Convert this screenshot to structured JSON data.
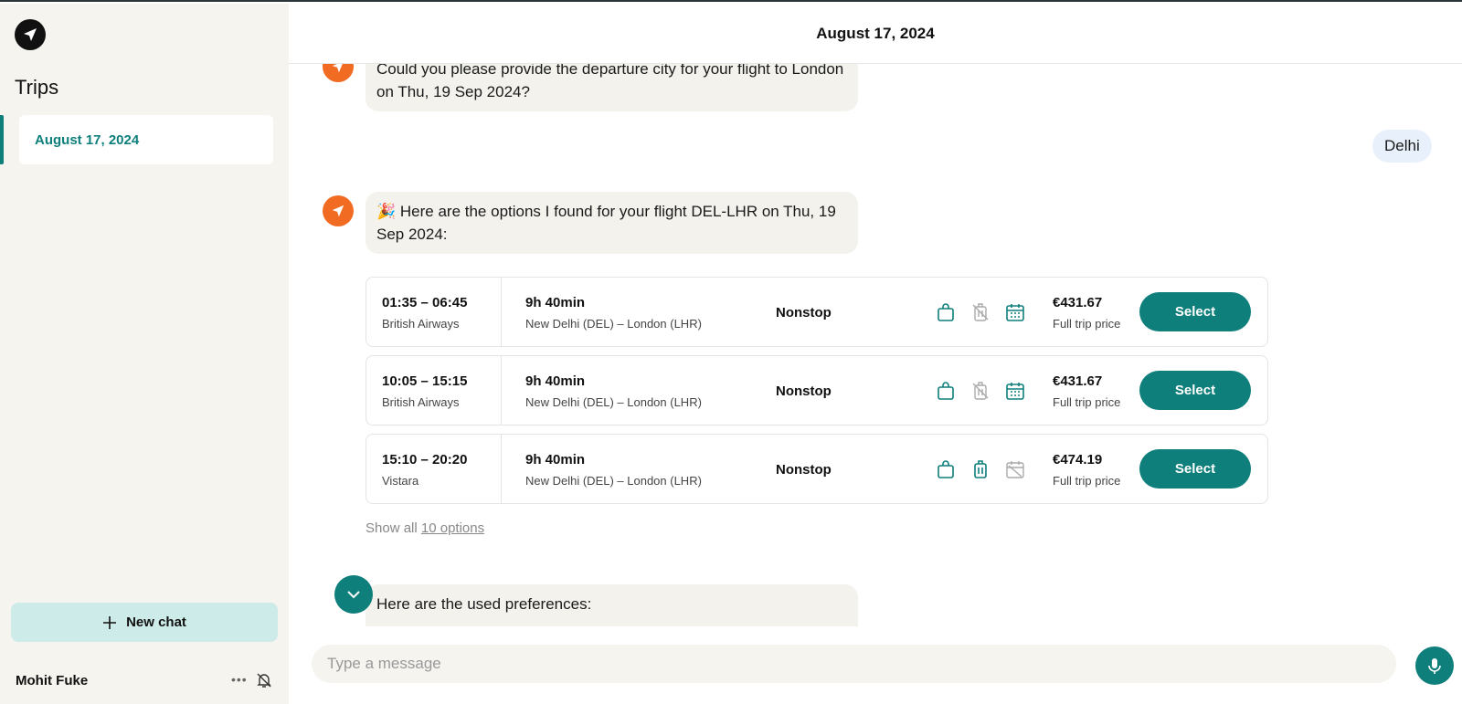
{
  "sidebar": {
    "title": "Trips",
    "trips": [
      {
        "label": "August 17, 2024",
        "active": true
      }
    ],
    "new_chat_label": "New chat",
    "user_name": "Mohit Fuke",
    "more_label": "•••"
  },
  "header": {
    "title": "August 17, 2024"
  },
  "chat": {
    "messages": {
      "assistant_1": "Could you please provide the departure city for your flight to London on Thu, 19 Sep 2024?",
      "user_1": "Delhi",
      "assistant_2": "🎉 Here are the options I found for your flight DEL-LHR on Thu, 19 Sep 2024:",
      "assistant_3": "Here are the used preferences:"
    },
    "flights": [
      {
        "times": "01:35 – 06:45",
        "airline": "British Airways",
        "duration": "9h 40min",
        "route": "New Delhi (DEL) – London (LHR)",
        "stops": "Nonstop",
        "price": "€431.67",
        "price_label": "Full trip price",
        "button": "Select",
        "bag_included": true,
        "luggage_included": false,
        "change_allowed": true
      },
      {
        "times": "10:05 – 15:15",
        "airline": "British Airways",
        "duration": "9h 40min",
        "route": "New Delhi (DEL) – London (LHR)",
        "stops": "Nonstop",
        "price": "€431.67",
        "price_label": "Full trip price",
        "button": "Select",
        "bag_included": true,
        "luggage_included": false,
        "change_allowed": true
      },
      {
        "times": "15:10 – 20:20",
        "airline": "Vistara",
        "duration": "9h 40min",
        "route": "New Delhi (DEL) – London (LHR)",
        "stops": "Nonstop",
        "price": "€474.19",
        "price_label": "Full trip price",
        "button": "Select",
        "bag_included": true,
        "luggage_included": true,
        "change_allowed": false
      }
    ],
    "show_all_prefix": "Show all",
    "show_all_link": "10 options"
  },
  "composer": {
    "placeholder": "Type a message"
  },
  "colors": {
    "accent": "#0e7f7b",
    "assistant_avatar": "#f26b23",
    "sidebar_bg": "#f6f4ef",
    "user_bubble": "#e8f1fb"
  }
}
